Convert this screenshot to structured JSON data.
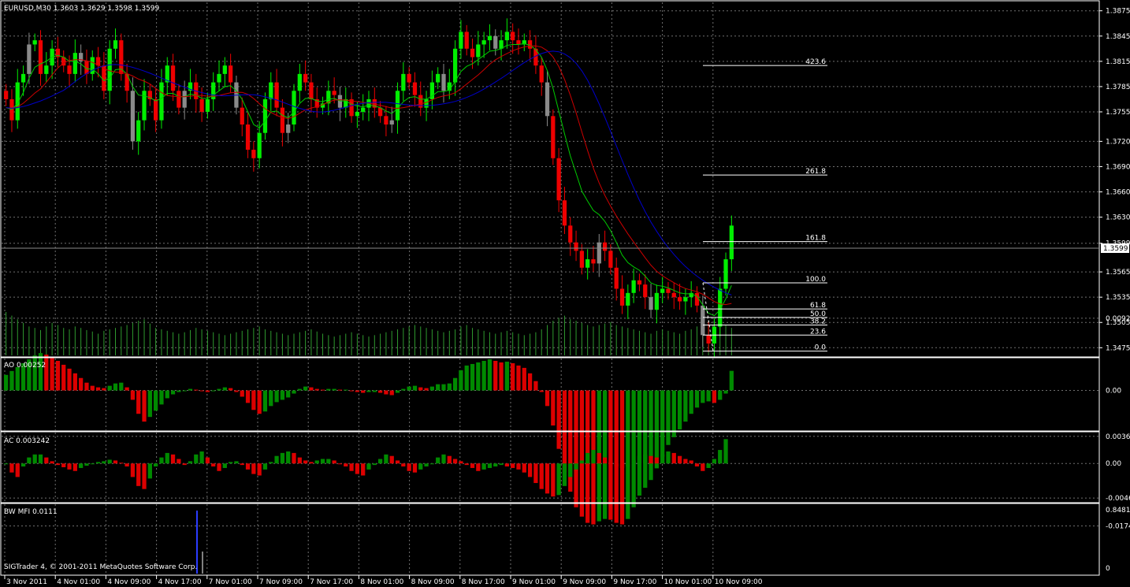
{
  "header": {
    "main": "EURUSD,M30  1.3603 1.3629 1.3598 1.3599",
    "ao": "AO 0.00252",
    "ac": "AC 0.003242",
    "bwmfi": "BW MFI 0.0111",
    "copyright": "SIGTrader 4, © 2001-2011 MetaQuotes Software Corp."
  },
  "colors": {
    "background": "#000000",
    "grid": "#6f6f6f",
    "bull": "#00ee00",
    "bear": "#ee0000",
    "neutral": "#8a8a8a",
    "ma_fast": "#00cc00",
    "ma_mid": "#cc0000",
    "ma_slow": "#0000cc",
    "volume": "#2f9a2f",
    "osc_up": "#008a00",
    "osc_down": "#dd0000",
    "mfi_bar": "#2b3cff",
    "text": "#ffffff"
  },
  "chart_data": [
    {
      "type": "candlestick",
      "symbol": "EURUSD",
      "timeframe": "M30",
      "ohlc_last": {
        "open": 1.3603,
        "high": 1.3629,
        "low": 1.3598,
        "close": 1.3599
      },
      "current_price": "1.3599",
      "ylim": [
        1.3465,
        1.3885
      ],
      "y_ticks": [
        "1.3875",
        "1.3845",
        "1.3815",
        "1.3785",
        "1.3755",
        "1.3720",
        "1.3690",
        "1.3660",
        "1.3630",
        "1.3599",
        "1.3565",
        "1.3535",
        "1.3505",
        "1.3475"
      ],
      "x_ticks": [
        "3 Nov 2011",
        "4 Nov 01:00",
        "4 Nov 09:00",
        "4 Nov 17:00",
        "7 Nov 01:00",
        "7 Nov 09:00",
        "7 Nov 17:00",
        "8 Nov 01:00",
        "8 Nov 09:00",
        "8 Nov 17:00",
        "9 Nov 01:00",
        "9 Nov 09:00",
        "9 Nov 17:00",
        "10 Nov 01:00",
        "10 Nov 09:00"
      ],
      "close_series": [
        1.377,
        1.3745,
        1.379,
        1.38,
        1.3835,
        1.384,
        1.38,
        1.381,
        1.383,
        1.382,
        1.381,
        1.38,
        1.3825,
        1.3815,
        1.38,
        1.382,
        1.381,
        1.378,
        1.383,
        1.384,
        1.38,
        1.378,
        1.372,
        1.3745,
        1.378,
        1.377,
        1.3745,
        1.379,
        1.381,
        1.378,
        1.376,
        1.378,
        1.379,
        1.377,
        1.3755,
        1.377,
        1.379,
        1.38,
        1.381,
        1.379,
        1.376,
        1.374,
        1.371,
        1.37,
        1.373,
        1.377,
        1.379,
        1.376,
        1.373,
        1.374,
        1.378,
        1.38,
        1.379,
        1.377,
        1.376,
        1.3765,
        1.378,
        1.3775,
        1.376,
        1.377,
        1.375,
        1.3755,
        1.376,
        1.377,
        1.376,
        1.375,
        1.374,
        1.3745,
        1.378,
        1.38,
        1.379,
        1.3775,
        1.376,
        1.377,
        1.379,
        1.38,
        1.378,
        1.379,
        1.383,
        1.385,
        1.383,
        1.382,
        1.3835,
        1.384,
        1.3845,
        1.383,
        1.384,
        1.385,
        1.384,
        1.3835,
        1.384,
        1.383,
        1.381,
        1.379,
        1.375,
        1.37,
        1.365,
        1.362,
        1.36,
        1.359,
        1.357,
        1.358,
        1.3575,
        1.36,
        1.359,
        1.357,
        1.3545,
        1.3525,
        1.354,
        1.3555,
        1.355,
        1.3535,
        1.352,
        1.354,
        1.3545,
        1.354,
        1.3535,
        1.353,
        1.3535,
        1.354,
        1.3525,
        1.349,
        1.348,
        1.35,
        1.3545,
        1.358,
        1.362
      ],
      "ma_fast_series": [
        1.376,
        1.3758,
        1.3765,
        1.3778,
        1.3795,
        1.3808,
        1.3812,
        1.3815,
        1.382,
        1.3822,
        1.382,
        1.3815,
        1.3815,
        1.3812,
        1.3806,
        1.3806,
        1.38,
        1.3792,
        1.3795,
        1.3805,
        1.3806,
        1.38,
        1.3785,
        1.3775,
        1.3774,
        1.3772,
        1.3768,
        1.3771,
        1.3777,
        1.3777,
        1.3773,
        1.3773,
        1.3776,
        1.3775,
        1.3771,
        1.3771,
        1.3775,
        1.378,
        1.3785,
        1.3786,
        1.378,
        1.377,
        1.3755,
        1.374,
        1.3736,
        1.3744,
        1.3755,
        1.3756,
        1.3751,
        1.3748,
        1.3755,
        1.3765,
        1.3771,
        1.3771,
        1.3768,
        1.3767,
        1.377,
        1.3771,
        1.3768,
        1.3768,
        1.3764,
        1.3762,
        1.3761,
        1.3763,
        1.3762,
        1.376,
        1.3756,
        1.3753,
        1.3759,
        1.3767,
        1.3772,
        1.3773,
        1.377,
        1.377,
        1.3774,
        1.3779,
        1.3779,
        1.3781,
        1.3791,
        1.3803,
        1.3809,
        1.3812,
        1.3817,
        1.3822,
        1.3827,
        1.3828,
        1.383,
        1.3834,
        1.3835,
        1.3835,
        1.3836,
        1.3834,
        1.3829,
        1.382,
        1.3804,
        1.3783,
        1.3756,
        1.3729,
        1.3703,
        1.3682,
        1.3661,
        1.3649,
        1.3638,
        1.3633,
        1.3625,
        1.3614,
        1.36,
        1.3585,
        1.3576,
        1.3571,
        1.3567,
        1.356,
        1.3552,
        1.3549,
        1.3548,
        1.3546,
        1.3543,
        1.354,
        1.3539,
        1.3539,
        1.3536,
        1.3526,
        1.3516,
        1.3513,
        1.352,
        1.3533,
        1.3549
      ],
      "fibonacci": {
        "levels": [
          "423.6",
          "261.8",
          "161.8",
          "100.0",
          "61.8",
          "50.0",
          "38.2",
          "23.6",
          "0.0"
        ],
        "prices": [
          1.381,
          1.368,
          1.3601,
          1.3552,
          1.3521,
          1.3511,
          1.3502,
          1.349,
          1.3471
        ]
      },
      "volume_series": [
        60,
        55,
        50,
        45,
        40,
        38,
        35,
        40,
        45,
        42,
        38,
        36,
        40,
        38,
        35,
        33,
        30,
        34,
        36,
        38,
        40,
        42,
        45,
        48,
        50,
        44,
        38,
        36,
        34,
        32,
        30,
        32,
        35,
        38,
        36,
        34,
        32,
        30,
        28,
        30,
        32,
        34,
        36,
        38,
        40,
        36,
        34,
        32,
        30,
        28,
        30,
        32,
        34,
        36,
        33,
        30,
        28,
        26,
        28,
        30,
        32,
        30,
        28,
        26,
        28,
        30,
        32,
        34,
        36,
        38,
        40,
        42,
        40,
        38,
        36,
        34,
        32,
        34,
        36,
        40,
        42,
        38,
        36,
        34,
        32,
        30,
        32,
        34,
        32,
        30,
        28,
        30,
        32,
        36,
        42,
        48,
        52,
        55,
        50,
        48,
        45,
        42,
        40,
        42,
        44,
        46,
        42,
        40,
        38,
        36,
        34,
        32,
        30,
        34,
        36,
        34,
        32,
        30,
        34,
        36,
        40,
        45,
        48,
        50,
        46,
        42,
        38
      ]
    },
    {
      "type": "bar",
      "title": "AO 0.00252",
      "name": "AO",
      "y_ticks": [
        "0.00927",
        "0.00",
        "-0.0174"
      ],
      "ylim": [
        -0.018,
        0.0095
      ],
      "values": [
        0.002,
        0.0025,
        0.003,
        0.0035,
        0.004,
        0.0045,
        0.0048,
        0.0046,
        0.0042,
        0.0038,
        0.0033,
        0.0028,
        0.0022,
        0.0016,
        0.001,
        0.0006,
        0.0004,
        0.0003,
        0.0006,
        0.0009,
        0.001,
        0.0004,
        -0.0012,
        -0.003,
        -0.004,
        -0.0034,
        -0.0026,
        -0.0018,
        -0.001,
        -0.0005,
        -0.0002,
        0.0,
        0.0002,
        0.0001,
        -0.0001,
        -0.0002,
        0.0,
        0.0002,
        0.0004,
        0.0003,
        -0.0002,
        -0.0008,
        -0.0016,
        -0.0025,
        -0.003,
        -0.0027,
        -0.002,
        -0.0015,
        -0.0012,
        -0.0009,
        -0.0004,
        0.0002,
        0.0005,
        0.0004,
        0.0002,
        0.0001,
        0.0002,
        0.0002,
        0.0001,
        0.0001,
        -0.0001,
        -0.0002,
        -0.0003,
        -0.0002,
        -0.0002,
        -0.0003,
        -0.0005,
        -0.0006,
        -0.0003,
        0.0002,
        0.0005,
        0.0006,
        0.0004,
        0.0003,
        0.0005,
        0.0008,
        0.0008,
        0.0009,
        0.0016,
        0.0026,
        0.0032,
        0.0034,
        0.0036,
        0.0038,
        0.004,
        0.0038,
        0.0036,
        0.0037,
        0.0035,
        0.0032,
        0.0029,
        0.0022,
        0.0012,
        -0.0002,
        -0.002,
        -0.0045,
        -0.0075,
        -0.0105,
        -0.013,
        -0.015,
        -0.0162,
        -0.017,
        -0.0172,
        -0.0168,
        -0.0165,
        -0.0166,
        -0.017,
        -0.0172,
        -0.0165,
        -0.015,
        -0.0135,
        -0.0125,
        -0.0115,
        -0.01,
        -0.0085,
        -0.007,
        -0.006,
        -0.005,
        -0.004,
        -0.003,
        -0.0022,
        -0.0016,
        -0.0014,
        -0.0016,
        -0.0012,
        -0.0004,
        0.00252
      ]
    },
    {
      "type": "bar",
      "title": "AC 0.003242",
      "name": "AC",
      "y_ticks": [
        "0.003610",
        "0.00",
        "-0.00460"
      ],
      "ylim": [
        -0.0048,
        0.0038
      ],
      "values": [
        0.0,
        -0.0012,
        -0.0018,
        -0.0004,
        0.0008,
        0.0012,
        0.0012,
        0.0008,
        0.0003,
        -0.0002,
        -0.0005,
        -0.0008,
        -0.001,
        -0.0006,
        -0.0003,
        0.0,
        0.0002,
        0.0003,
        0.0005,
        0.0004,
        0.0001,
        -0.0004,
        -0.0018,
        -0.003,
        -0.0034,
        -0.002,
        -0.0004,
        0.0008,
        0.0014,
        0.0012,
        0.0006,
        -0.0002,
        0.0003,
        0.0012,
        0.0016,
        0.0008,
        -0.0004,
        -0.001,
        -0.0006,
        0.0002,
        0.0003,
        -0.0002,
        -0.0008,
        -0.0014,
        -0.0016,
        -0.0008,
        0.0002,
        0.001,
        0.0014,
        0.0016,
        0.0014,
        0.0008,
        0.0004,
        0.0002,
        0.0004,
        0.0006,
        0.0006,
        0.0004,
        0.0,
        -0.0004,
        -0.001,
        -0.0014,
        -0.0016,
        -0.0008,
        -0.0002,
        0.0006,
        0.0012,
        0.001,
        0.0004,
        -0.0004,
        -0.001,
        -0.0012,
        -0.0008,
        -0.0004,
        0.0,
        0.0008,
        0.0012,
        0.001,
        0.0006,
        0.0003,
        -0.0002,
        -0.0006,
        -0.001,
        -0.0008,
        -0.0006,
        -0.0004,
        -0.0002,
        -0.0004,
        -0.0006,
        -0.0008,
        -0.0012,
        -0.0018,
        -0.0026,
        -0.0034,
        -0.004,
        -0.0044,
        -0.0042,
        -0.003,
        -0.0018,
        -0.0008,
        0.0004,
        0.0014,
        0.0018,
        0.0014,
        0.0008,
        0.0002,
        -0.0004,
        -0.0006,
        -0.0004,
        0.0004,
        0.001,
        0.0012,
        0.001,
        0.0008,
        0.0012,
        0.0016,
        0.0014,
        0.001,
        0.0006,
        0.0004,
        -0.0004,
        -0.001,
        -0.0006,
        0.0006,
        0.0018,
        0.003242
      ]
    },
    {
      "type": "bar",
      "title": "BW MFI 0.0111",
      "name": "BW MFI",
      "y_ticks": [
        "0.8481",
        "0"
      ],
      "ylim": [
        0,
        0.8481
      ],
      "values": [
        0.0111
      ]
    }
  ]
}
